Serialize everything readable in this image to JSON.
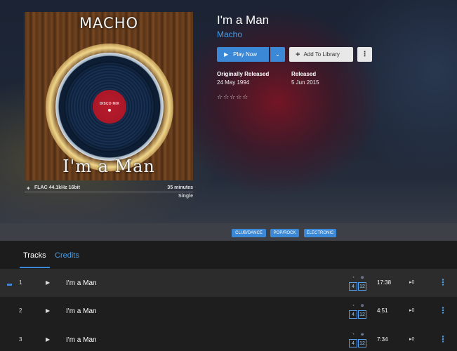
{
  "album": {
    "title": "I'm a Man",
    "artist": "Macho",
    "cover": {
      "artist_text": "MACHO",
      "title_text": "I'm a Man",
      "label_text": "DISCO MIX"
    },
    "quality": {
      "icon": "tidal-icon",
      "format": "FLAC 44.1kHz 16bit",
      "duration": "35 minutes",
      "kind": "Single"
    },
    "actions": {
      "play_label": "Play Now",
      "add_label": "Add To Library"
    },
    "meta": {
      "originally_released_label": "Originally Released",
      "originally_released_value": "24 May 1994",
      "released_label": "Released",
      "released_value": "5 Jun 2015"
    },
    "rating": {
      "stars": 0,
      "max": 5,
      "display": "☆☆☆☆☆"
    },
    "genres": [
      "CLUB/DANCE",
      "POP/ROCK",
      "ELECTRONIC"
    ]
  },
  "tabs": [
    {
      "label": "Tracks",
      "active": true
    },
    {
      "label": "Credits",
      "active": false
    }
  ],
  "tracks": [
    {
      "number": "1",
      "title": "I'm a Man",
      "quality_top": "4",
      "quality_bottom": "12",
      "duration": "17:38",
      "plays": "▸0",
      "active": true
    },
    {
      "number": "2",
      "title": "I'm a Man",
      "quality_top": "4",
      "quality_bottom": "12",
      "duration": "4:51",
      "plays": "▸0",
      "active": false
    },
    {
      "number": "3",
      "title": "I'm a Man",
      "quality_top": "4",
      "quality_bottom": "12",
      "duration": "7:34",
      "plays": "▸0",
      "active": false
    }
  ],
  "colors": {
    "accent": "#3b89d6",
    "link": "#4a9de6",
    "background": "#1e1e1e"
  }
}
